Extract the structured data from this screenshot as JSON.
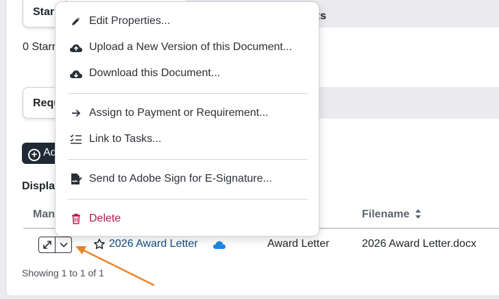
{
  "tabs": {
    "starred_label": "Starred",
    "requirements_label": "Requirements",
    "right_band_text": "nts"
  },
  "starred_count_text": "0 Starred",
  "add_button_label": "Add",
  "display_label": "Display",
  "table": {
    "col_manage": "Manage",
    "col_filename": "Filename",
    "row": {
      "document_name": "2026 Award Letter",
      "type": "Award Letter",
      "filename": "2026 Award Letter.docx"
    },
    "footer": "Showing 1 to 1 of 1"
  },
  "context_menu": {
    "items": [
      {
        "label": "Edit Properties...",
        "icon": "pencil-icon"
      },
      {
        "label": "Upload a New Version of this Document...",
        "icon": "cloud-upload-icon"
      },
      {
        "label": "Download this Document...",
        "icon": "cloud-download-icon"
      },
      {
        "label": "Assign to Payment or Requirement...",
        "icon": "arrow-right-icon"
      },
      {
        "label": "Link to Tasks...",
        "icon": "checklist-icon"
      },
      {
        "label": "Send to Adobe Sign for E-Signature...",
        "icon": "signature-icon"
      },
      {
        "label": "Delete",
        "icon": "trash-icon"
      }
    ]
  },
  "colors": {
    "link": "#0f4c81",
    "danger": "#b8174a",
    "annotation_arrow": "#e6842a",
    "cloud": "#1e88e5"
  }
}
